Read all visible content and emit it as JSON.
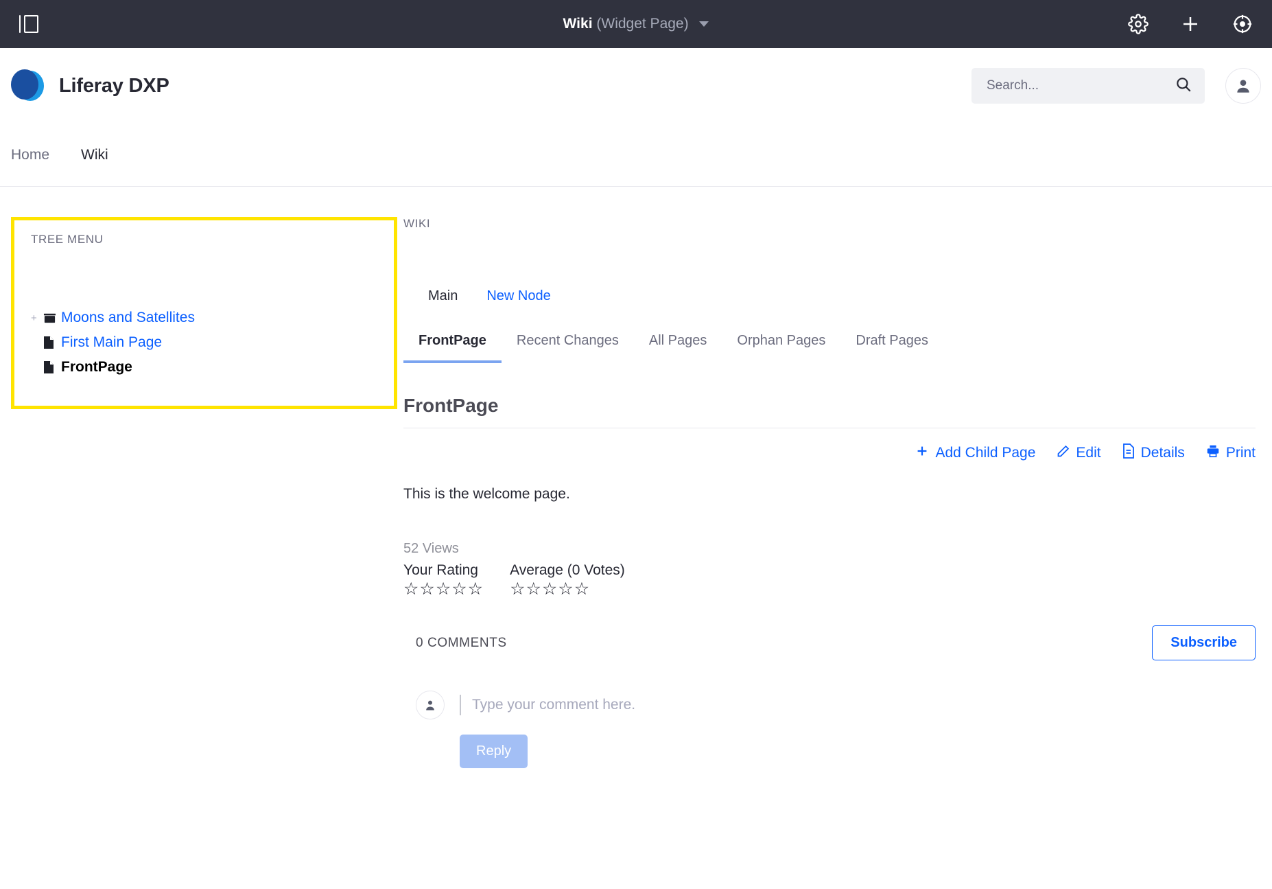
{
  "topbar": {
    "panel_toggle_icon": "sidebar-panel-icon",
    "title_main": "Wiki",
    "title_sub": "(Widget Page)",
    "caret": "▼",
    "actions": [
      {
        "icon": "gear-icon",
        "label": "Settings"
      },
      {
        "icon": "plus-icon",
        "label": "Add"
      },
      {
        "icon": "target-icon",
        "label": "Preview"
      }
    ]
  },
  "header": {
    "brand_name": "Liferay DXP",
    "logo_icon": "liferay-logo",
    "logo_color_light": "#1C9AE5",
    "logo_color_dark": "#1A4FA0",
    "search": {
      "placeholder": "Search...",
      "icon": "search-icon"
    },
    "avatar_icon": "user-avatar-icon"
  },
  "sitenav": {
    "items": [
      {
        "label": "Home",
        "active": false
      },
      {
        "label": "Wiki",
        "active": true
      }
    ]
  },
  "tree_menu": {
    "portlet_label": "TREE MENU",
    "highlight_color": "#FFE400",
    "items": [
      {
        "expander": "+",
        "icon": "folder-icon",
        "label": "Moons and Satellites",
        "current": false
      },
      {
        "expander": "",
        "icon": "page-icon",
        "label": "First Main Page",
        "current": false
      },
      {
        "expander": "",
        "icon": "page-icon",
        "label": "FrontPage",
        "current": true
      }
    ]
  },
  "wiki": {
    "portlet_label": "WIKI",
    "node_tabs": [
      {
        "label": "Main",
        "active": true
      },
      {
        "label": "New Node",
        "active": false
      }
    ],
    "page_tabs": [
      {
        "label": "FrontPage",
        "active": true
      },
      {
        "label": "Recent Changes",
        "active": false
      },
      {
        "label": "All Pages",
        "active": false
      },
      {
        "label": "Orphan Pages",
        "active": false
      },
      {
        "label": "Draft Pages",
        "active": false
      }
    ],
    "page_title": "FrontPage",
    "actions": [
      {
        "icon": "plus-icon",
        "label": "Add Child Page"
      },
      {
        "icon": "pencil-icon",
        "label": "Edit"
      },
      {
        "icon": "document-icon",
        "label": "Details"
      },
      {
        "icon": "print-icon",
        "label": "Print"
      }
    ],
    "body_text": "This is the welcome page.",
    "views": "52 Views",
    "ratings": [
      {
        "label": "Your Rating",
        "stars": "☆☆☆☆☆"
      },
      {
        "label": "Average (0 Votes)",
        "stars": "☆☆☆☆☆"
      }
    ],
    "comments": {
      "count_label": "0 COMMENTS",
      "subscribe_label": "Subscribe",
      "compose_placeholder": "Type your comment here.",
      "reply_label": "Reply",
      "avatar_icon": "user-avatar-icon"
    }
  },
  "colors": {
    "topbar_bg": "#30323E",
    "link_blue": "#0B5FFF",
    "muted": "#6B6C7E",
    "reply_blue": "#A3BFF5",
    "tab_underline": "#7BA4F0"
  }
}
